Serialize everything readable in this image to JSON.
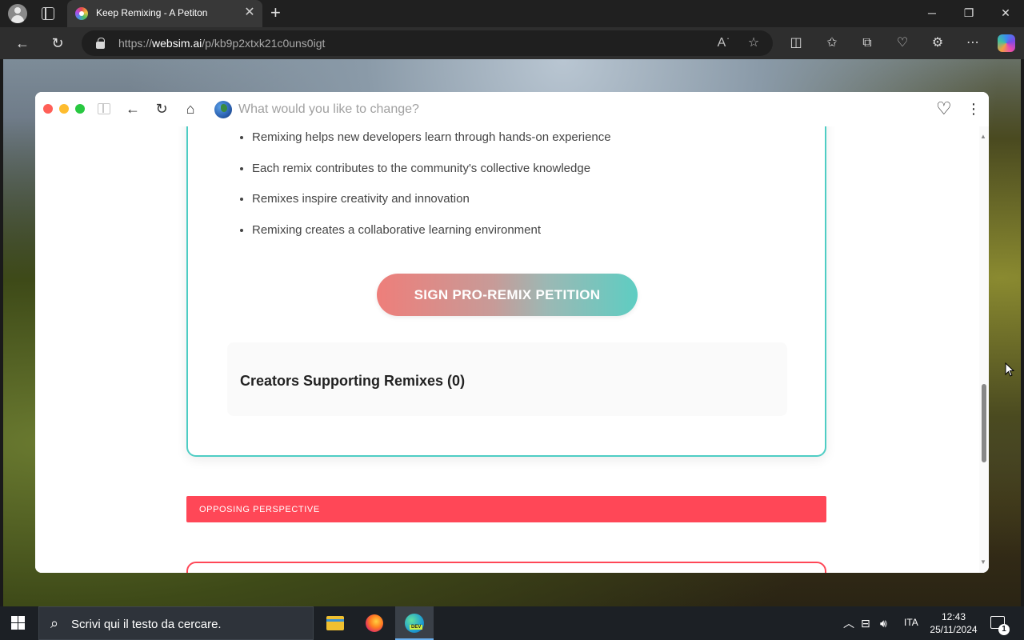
{
  "browser": {
    "tab_title": "Keep Remixing - A Petiton",
    "tab_close": "✕",
    "new_tab": "+",
    "url_scheme_prefix": "https://",
    "url_host": "websim.ai",
    "url_path": "/p/kb9p2xtxk21c0uns0igt",
    "window_controls": [
      "─",
      "❐",
      "✕"
    ]
  },
  "websim": {
    "search_placeholder": "What would you like to change?",
    "dots": [
      "#ff5f57",
      "#febc2e",
      "#28c840"
    ]
  },
  "petition": {
    "points": [
      "Remixing helps new developers learn through hands-on experience",
      "Each remix contributes to the community's collective knowledge",
      "Remixes inspire creativity and innovation",
      "Remixing creates a collaborative learning environment"
    ],
    "sign_button": "SIGN PRO-REMIX PETITION",
    "supporters_title": "Creators Supporting Remixes (0)",
    "opposing_label": "OPPOSING PERSPECTIVE"
  },
  "colors": {
    "accent_teal": "#4ecdc4",
    "accent_red": "#ff4757"
  },
  "taskbar": {
    "search_placeholder": "Scrivi qui il testo da cercare.",
    "language": "ITA",
    "time": "12:43",
    "date": "25/11/2024",
    "notification_count": "1"
  }
}
